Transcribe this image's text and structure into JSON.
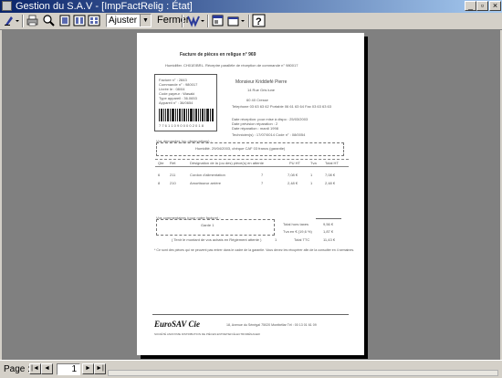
{
  "window": {
    "title": "Gestion du S.A.V - [ImpFactRelig : État]"
  },
  "toolbar": {
    "zoom_value": "Ajuster",
    "close_label": "Fermer"
  },
  "statusbar": {
    "page_label": "Page :",
    "page_number": "1"
  },
  "report": {
    "title": "Facture de pièces en religue n° 969",
    "subtitle": "Humidifier. CH01E/BRL. Réceptre parallèle de réception de commande n° 980017",
    "info_lines": [
      "Facture n° : 2843",
      "Commande n° : 980017",
      "Livrée le : 08/04",
      "Code payeur : Wasaki",
      "Type appareil : 36.0653",
      "Appareil n° : 36/0654"
    ],
    "barcode_text": "7 7 6 1 1 0 9 0 0 0 0 2 0 1 8",
    "client_name": "Monsieur Kriddiefé    Pierre",
    "client_lines": [
      "14 Rue Gris lune",
      "60 40   Cresse",
      "Telephone 03 63 63 62    Portable 06 61 63 64    Fax 03 63 63 63",
      "Date réception: pour mise à dispo : 25/03/2003",
      "Date prévision réparation :   2",
      "Date réparation :   mardi 1998",
      "Technicien(s) : 17/07/0014    Code n° : 08/0054"
    ],
    "remarks_label": "Vos demandes (ou observations) :",
    "remarks_text": "Humidité. 29/04/2003, chèque CAF 03 francs (garantie)",
    "table_headers": [
      "Qte",
      "Réf.",
      "Désignation de la (ou des) pièce(s) en attente",
      "PU HT",
      "Tva",
      "Total HT"
    ],
    "rows": [
      {
        "qty": "6",
        "ref": "211",
        "desc": "Cordon d'alimentation",
        "pu": "7",
        "tva": "7,08 €",
        "tax": "1",
        "total": "7,08 €"
      },
      {
        "qty": "8",
        "ref": "210",
        "desc": "Amortisseur arrière",
        "pu": "7",
        "tva": "2,48 €",
        "tax": "1",
        "total": "2,48 €"
      }
    ],
    "comment_label": "Vos commentaires (pour notre facture) :",
    "comment_value": "Garde 1",
    "totals": [
      {
        "label": "Total hors taxes",
        "value": "9,56 €"
      },
      {
        "label": "Tva en € (19,6 %)",
        "value": "1,87 €"
      },
      {
        "label": "Total TTC",
        "value": "11,43 €"
      }
    ],
    "reglement_line": "( Tenir le montant de vos achats en Règlement attente )",
    "reglement_value": "1",
    "footnote": "* Ce sont des pièces qui ne peuvent pas entrer dans le cadre de la garantie. Vous devez les récupérer afin de la consulter en 4 semaines.",
    "brand": "EuroSAV Cie",
    "address": "18, Avenue du Sénégal   75020 Montbéliar   Tél : 00 13 01 61 09",
    "footer_small": "SOCIÉTÉ ANONYME   DISTRIBUTION   DE PIÈCES   ENTRETIEN   ÉLECTROMÉNAGER"
  }
}
